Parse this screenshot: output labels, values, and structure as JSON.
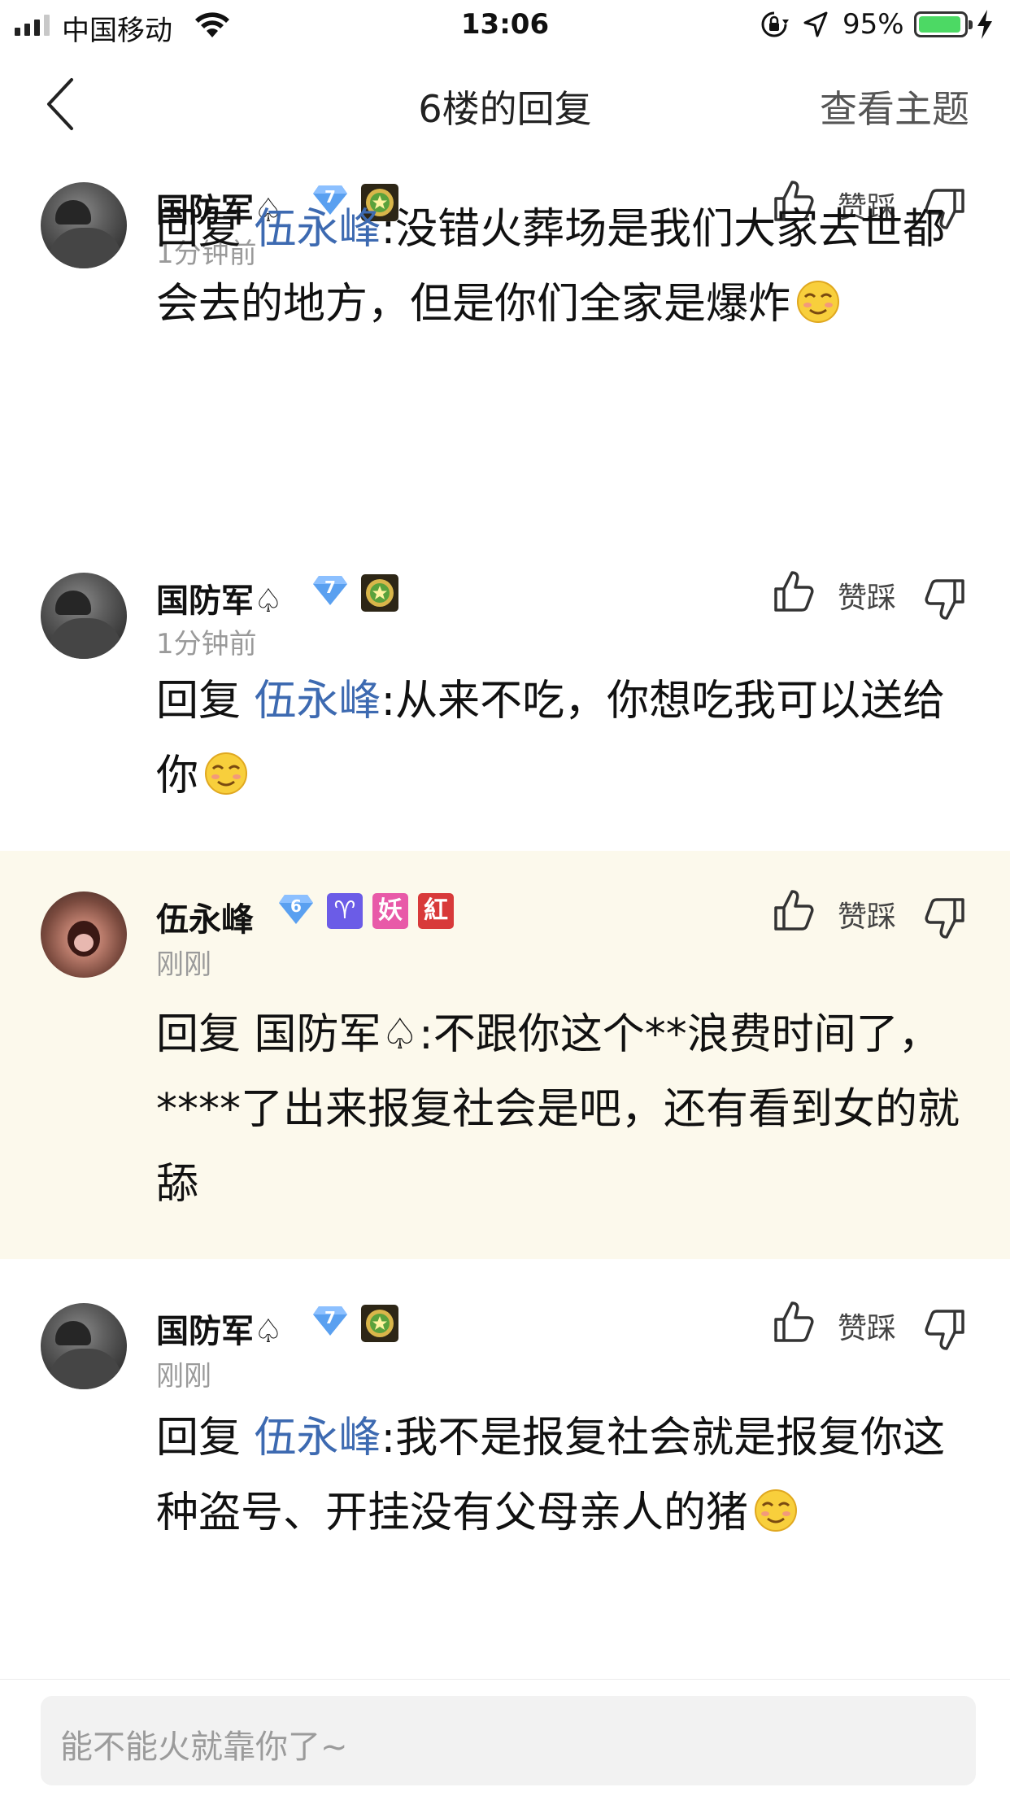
{
  "status_bar": {
    "carrier": "中国移动",
    "time": "13:06",
    "battery_percent": "95%",
    "battery_level": 0.95,
    "icons": [
      "signal-icon",
      "wifi-icon",
      "orientation-lock-icon",
      "location-icon",
      "battery-icon",
      "charging-icon"
    ]
  },
  "nav": {
    "title": "6楼的回复",
    "right_action": "查看主题",
    "back_icon": "chevron-left-icon"
  },
  "colors": {
    "mention": "#3d6ab1",
    "highlight_bg": "#fcf9ec",
    "time_text": "#9a9a9a",
    "battery_fill": "#4cd964"
  },
  "comments": [
    {
      "user": "国防军♤",
      "badges": [
        "diamond-level-7",
        "star-medal"
      ],
      "level": "7",
      "time": "1分钟前",
      "actions": {
        "vote_label": "赞踩"
      },
      "reply_prefix": "回复",
      "mention": "伍永峰",
      "text": ":没错火葬场是我们大家去世都会去的地方，但是你们全家是爆炸",
      "emoji": "smirk-face-emoji",
      "highlighted": false
    },
    {
      "user": "国防军♤",
      "badges": [
        "diamond-level-7",
        "star-medal"
      ],
      "level": "7",
      "time": "1分钟前",
      "actions": {
        "vote_label": "赞踩"
      },
      "reply_prefix": "回复",
      "mention": "伍永峰",
      "text": ":从来不吃，你想吃我可以送给你",
      "emoji": "smirk-face-emoji",
      "highlighted": false
    },
    {
      "user": "伍永峰",
      "badges": [
        "diamond-level-6",
        "aries-badge",
        "yao-badge",
        "hong-badge"
      ],
      "level": "6",
      "badge_aries": "♈",
      "badge_yao": "妖",
      "badge_hong": "紅",
      "time": "刚刚",
      "actions": {
        "vote_label": "赞踩"
      },
      "reply_prefix": "回复",
      "mention": "国防军♤",
      "text": ":不跟你这个**浪费时间了，****了出来报复社会是吧，还有看到女的就舔",
      "highlighted": true
    },
    {
      "user": "国防军♤",
      "badges": [
        "diamond-level-7",
        "star-medal"
      ],
      "level": "7",
      "time": "刚刚",
      "actions": {
        "vote_label": "赞踩"
      },
      "reply_prefix": "回复",
      "mention": "伍永峰",
      "text": ":我不是报复社会就是报复你这种盗号、开挂没有父母亲人的猪",
      "emoji": "smirk-face-emoji",
      "highlighted": false
    }
  ],
  "input": {
    "placeholder": "能不能火就靠你了~"
  }
}
